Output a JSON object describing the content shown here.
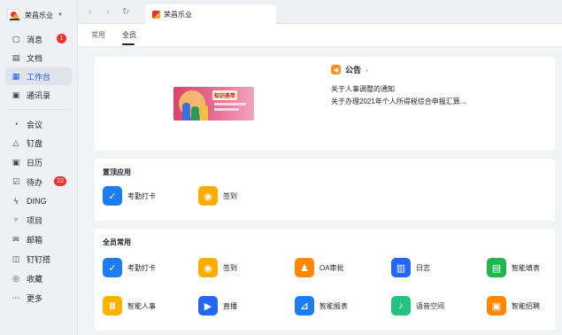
{
  "org": {
    "name": "荣昌乐业"
  },
  "nav": {
    "items": [
      {
        "label": "消息",
        "icon": "message-icon",
        "badge": "1"
      },
      {
        "label": "文档",
        "icon": "doc-icon"
      },
      {
        "label": "工作台",
        "icon": "workbench-icon",
        "active": true
      },
      {
        "label": "通讯录",
        "icon": "contacts-icon"
      },
      {
        "label": "会议",
        "icon": "meeting-icon"
      },
      {
        "label": "钉盘",
        "icon": "drive-icon"
      },
      {
        "label": "日历",
        "icon": "calendar-icon"
      },
      {
        "label": "待办",
        "icon": "todo-icon",
        "badge": "22"
      },
      {
        "label": "DING",
        "icon": "ding-icon"
      },
      {
        "label": "项目",
        "icon": "project-icon"
      },
      {
        "label": "邮箱",
        "icon": "mail-icon"
      },
      {
        "label": "钉钉搭",
        "icon": "builder-icon"
      },
      {
        "label": "收藏",
        "icon": "favorite-icon"
      },
      {
        "label": "更多",
        "icon": "more-icon"
      }
    ]
  },
  "window": {
    "tab_title": "荣昌乐业"
  },
  "subtabs": [
    {
      "label": "常用"
    },
    {
      "label": "全员",
      "active": true
    }
  ],
  "notice": {
    "title": "公告",
    "items": [
      "关于人事调整的通知",
      "关于办理2021年个人所得税综合申报汇算..."
    ],
    "banner_text": "知识荟萃"
  },
  "pinned": {
    "title": "置顶应用",
    "apps": [
      {
        "label": "考勤打卡",
        "color": "#1e7cf2",
        "icon": "attendance-icon",
        "glyph": "✓"
      },
      {
        "label": "签到",
        "color": "#ffab00",
        "icon": "checkin-icon",
        "glyph": "◉"
      }
    ]
  },
  "all_apps": {
    "title": "全员常用",
    "apps": [
      {
        "label": "考勤打卡",
        "color": "#1e7cf2",
        "icon": "attendance-icon",
        "glyph": "✓"
      },
      {
        "label": "签到",
        "color": "#ffab00",
        "icon": "checkin-icon",
        "glyph": "◉"
      },
      {
        "label": "OA审批",
        "color": "#ff8800",
        "icon": "approval-icon",
        "glyph": "♟"
      },
      {
        "label": "日志",
        "color": "#2468f2",
        "icon": "log-icon",
        "glyph": "▥"
      },
      {
        "label": "智能填表",
        "color": "#1fb650",
        "icon": "form-icon",
        "glyph": "▤"
      },
      {
        "label": "智能人事",
        "color": "#ffb300",
        "icon": "hr-icon",
        "glyph": "Ⅱ"
      },
      {
        "label": "直播",
        "color": "#2468f2",
        "icon": "live-icon",
        "glyph": "▶"
      },
      {
        "label": "智能报表",
        "color": "#1e7cf2",
        "icon": "report-icon",
        "glyph": "⊿"
      },
      {
        "label": "语音空间",
        "color": "#26c281",
        "icon": "voice-space-icon",
        "glyph": "♪"
      },
      {
        "label": "智能招聘",
        "color": "#ff8800",
        "icon": "recruit-icon",
        "glyph": "▣"
      }
    ]
  }
}
